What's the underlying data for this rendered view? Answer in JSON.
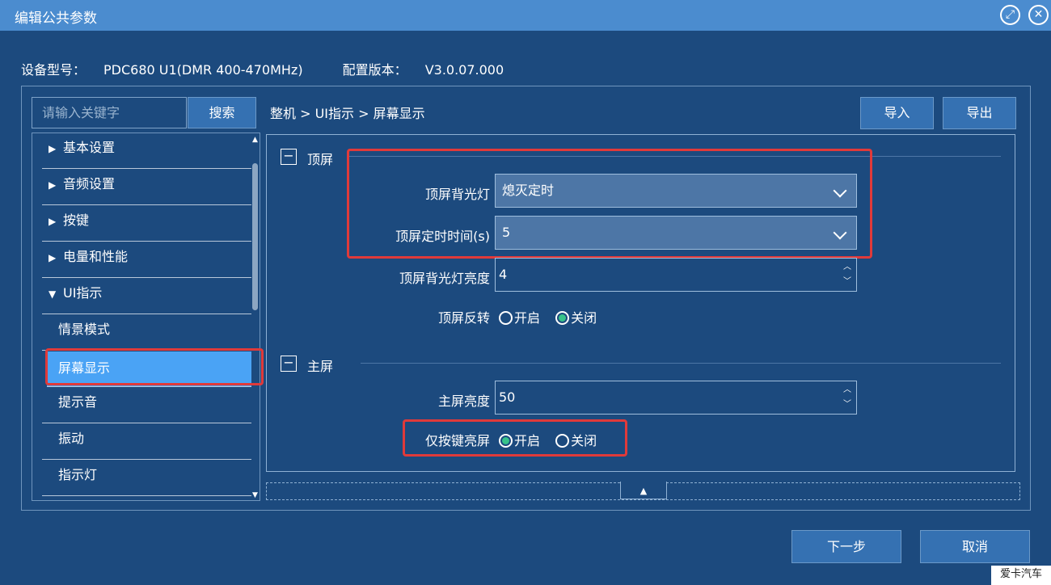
{
  "window": {
    "title": "编辑公共参数",
    "restore_icon": "restore-icon",
    "close_icon": "close-icon"
  },
  "device_info": {
    "model_label": "设备型号：",
    "model_value": "PDC680 U1(DMR 400-470MHz)",
    "version_label": "配置版本：",
    "version_value": "V3.0.07.000"
  },
  "search": {
    "placeholder": "请输入关键字",
    "button_label": "搜索"
  },
  "tree": {
    "items": [
      {
        "label": "基本设置",
        "expanded": false
      },
      {
        "label": "音频设置",
        "expanded": false
      },
      {
        "label": "按键",
        "expanded": false
      },
      {
        "label": "电量和性能",
        "expanded": false
      },
      {
        "label": "UI指示",
        "expanded": true
      },
      {
        "label": "情景模式"
      },
      {
        "label": "屏幕显示",
        "selected": true
      },
      {
        "label": "提示音"
      },
      {
        "label": "振动"
      },
      {
        "label": "指示灯"
      }
    ]
  },
  "breadcrumb": "整机 > UI指示 > 屏幕显示",
  "toolbar": {
    "import_label": "导入",
    "export_label": "导出"
  },
  "top_screen": {
    "title": "顶屏",
    "backlight_label": "顶屏背光灯",
    "backlight_value": "熄灭定时",
    "timer_label": "顶屏定时时间(s)",
    "timer_value": "5",
    "brightness_label": "顶屏背光灯亮度",
    "brightness_value": "4",
    "flip_label": "顶屏反转",
    "flip_on_label": "开启",
    "flip_off_label": "关闭",
    "flip_selected": "off"
  },
  "main_screen": {
    "title": "主屏",
    "brightness_label": "主屏亮度",
    "brightness_value": "50",
    "key_wake_label": "仅按键亮屏",
    "key_wake_on_label": "开启",
    "key_wake_off_label": "关闭",
    "key_wake_selected": "on"
  },
  "footer": {
    "next_label": "下一步",
    "cancel_label": "取消"
  },
  "watermark": "爱卡汽车",
  "colors": {
    "background": "#1c4a7e",
    "titlebar": "#4b8ccf",
    "selected_item": "#4aa3f5",
    "highlight_box": "#e03a3a",
    "radio_on": "#37c38a"
  }
}
